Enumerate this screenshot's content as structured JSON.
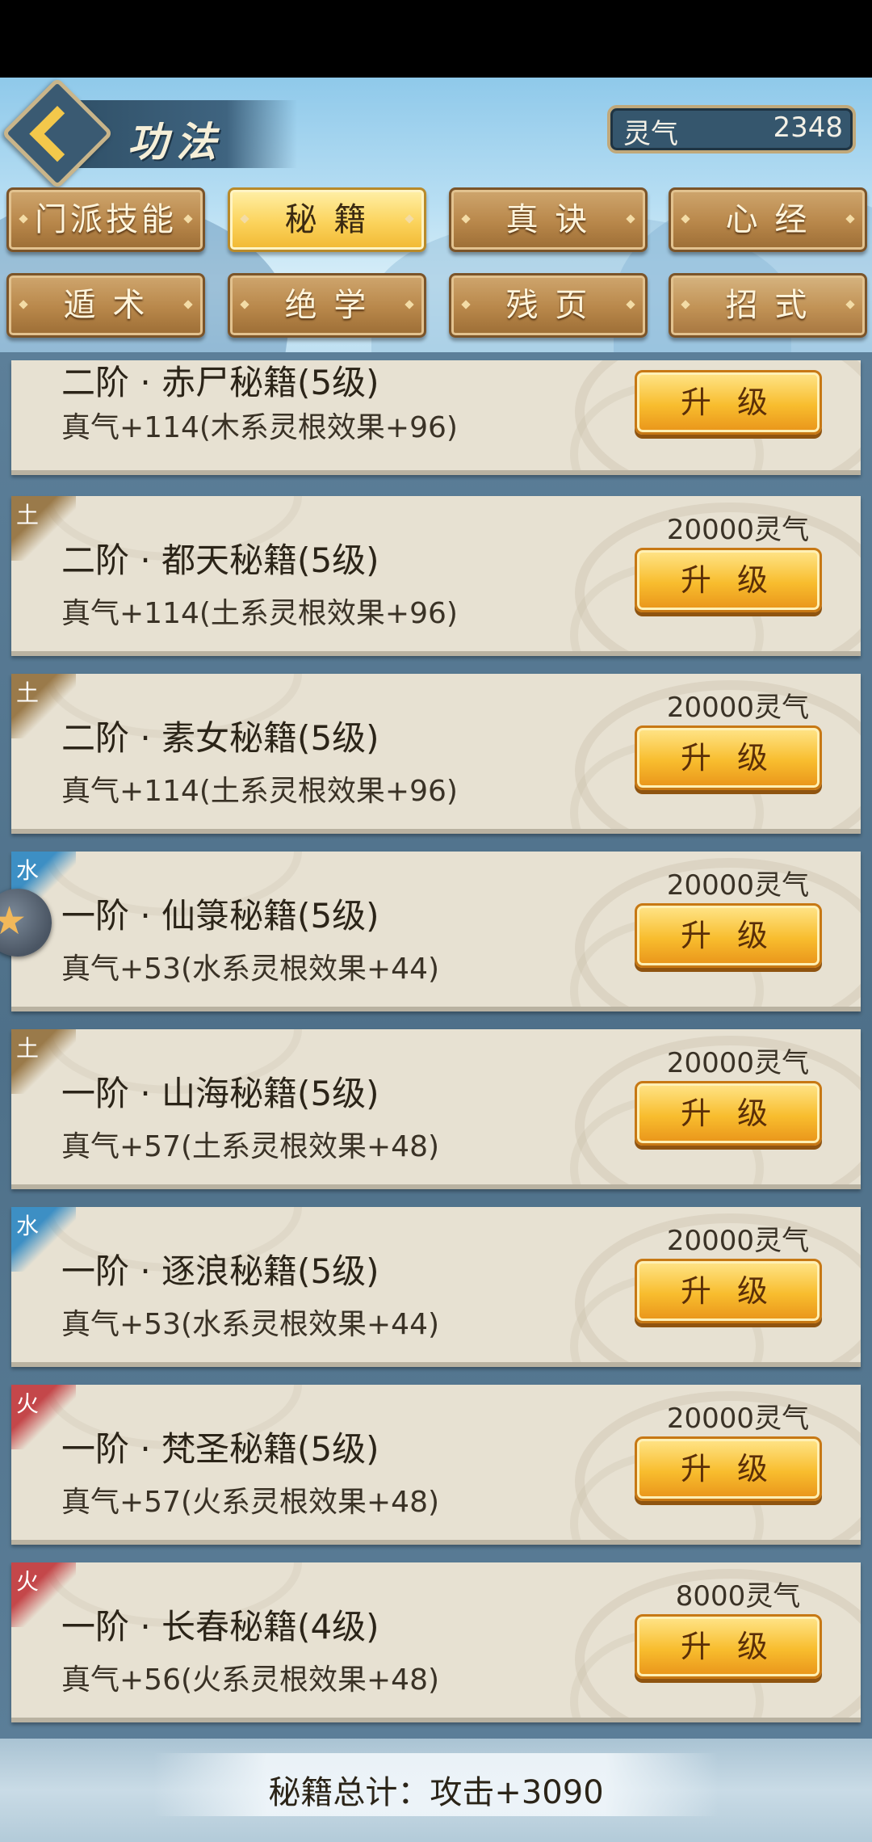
{
  "header": {
    "title": "功法",
    "currency": {
      "label": "灵气",
      "value": "2348"
    }
  },
  "tabs": [
    {
      "label": "门派技能",
      "active": false
    },
    {
      "label": "秘 籍",
      "active": true
    },
    {
      "label": "真 诀",
      "active": false
    },
    {
      "label": "心 经",
      "active": false
    },
    {
      "label": "遁 术",
      "active": false
    },
    {
      "label": "绝 学",
      "active": false
    },
    {
      "label": "残 页",
      "active": false
    },
    {
      "label": "招 式",
      "active": false
    }
  ],
  "items": [
    {
      "element": "",
      "title": "二阶 · 赤尸秘籍(5级)",
      "desc": "真气+114(木系灵根效果+96)",
      "cost": "",
      "button": "升 级"
    },
    {
      "element": "土",
      "element_color": "#9a7a4a",
      "title": "二阶 · 都天秘籍(5级)",
      "desc": "真气+114(土系灵根效果+96)",
      "cost": "20000灵气",
      "button": "升 级"
    },
    {
      "element": "土",
      "element_color": "#9a7a4a",
      "title": "二阶 · 素女秘籍(5级)",
      "desc": "真气+114(土系灵根效果+96)",
      "cost": "20000灵气",
      "button": "升 级"
    },
    {
      "element": "水",
      "element_color": "#3d8fc4",
      "title": "一阶 · 仙箓秘籍(5级)",
      "desc": "真气+53(水系灵根效果+44)",
      "cost": "20000灵气",
      "button": "升 级"
    },
    {
      "element": "土",
      "element_color": "#9a7a4a",
      "title": "一阶 · 山海秘籍(5级)",
      "desc": "真气+57(土系灵根效果+48)",
      "cost": "20000灵气",
      "button": "升 级"
    },
    {
      "element": "水",
      "element_color": "#3d8fc4",
      "title": "一阶 · 逐浪秘籍(5级)",
      "desc": "真气+53(水系灵根效果+44)",
      "cost": "20000灵气",
      "button": "升 级"
    },
    {
      "element": "火",
      "element_color": "#c4474a",
      "title": "一阶 · 梵圣秘籍(5级)",
      "desc": "真气+57(火系灵根效果+48)",
      "cost": "20000灵气",
      "button": "升 级"
    },
    {
      "element": "火",
      "element_color": "#c4474a",
      "title": "一阶 · 长春秘籍(4级)",
      "desc": "真气+56(火系灵根效果+48)",
      "cost": "8000灵气",
      "button": "升 级"
    }
  ],
  "footer": {
    "summary": "秘籍总计：攻击+3090"
  }
}
